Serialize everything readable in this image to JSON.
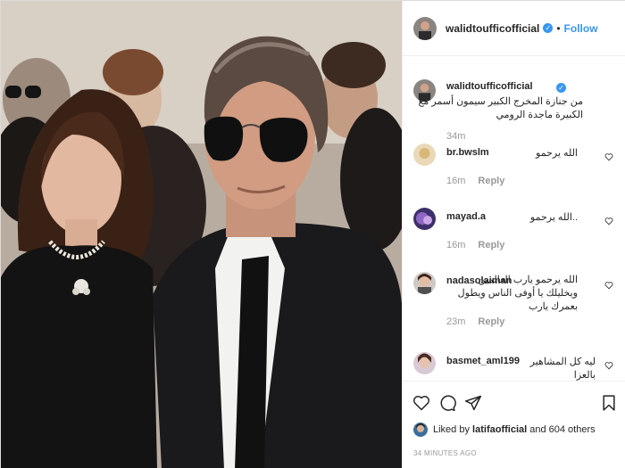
{
  "post": {
    "photo_alt": "",
    "header": {
      "username": "walidtoufficofficial",
      "verified_mark": "✓",
      "separator": "•",
      "follow_label": "Follow"
    },
    "caption": {
      "username": "walidtoufficofficial",
      "text": "من جنازة المخرج الكبير سيمون أسمر مع الكبيرة ماجدة الرومي",
      "time": "34m"
    },
    "comments": [
      {
        "username": "br.bwslm",
        "text": "الله يرحمو",
        "time": "16m",
        "reply_label": "Reply"
      },
      {
        "username": "mayad.a",
        "text": "..الله يرحمو",
        "time": "16m",
        "reply_label": "Reply"
      },
      {
        "username": "nadasolaiman",
        "text": "الله يرحمو يارب العالمين ويخليلك يا أوفى الناس ويطول بعمرك يارب",
        "time": "23m",
        "reply_label": "Reply"
      },
      {
        "username": "basmet_aml199",
        "text": "ليه كل المشاهير بالعزا",
        "time": "",
        "reply_label": ""
      }
    ],
    "likes": {
      "prefix": "Liked by ",
      "user": "latifaofficial",
      "suffix": " and 604 others"
    },
    "timestamp": "34 MINUTES AGO",
    "icons": {
      "like": "heart-outline-icon",
      "comment": "speech-bubble-icon",
      "share": "paper-plane-icon",
      "save": "bookmark-icon",
      "comment_like": "small-heart-icon"
    },
    "colors": {
      "accent": "#3897f0",
      "muted": "#999999",
      "text": "#262626",
      "border": "#efefef"
    }
  }
}
